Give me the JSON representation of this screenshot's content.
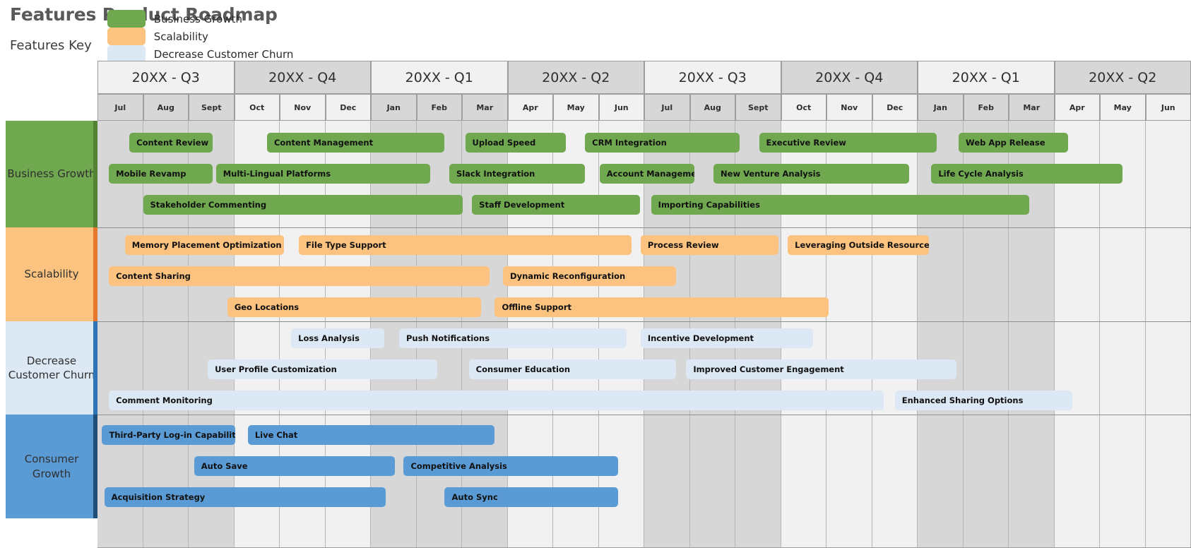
{
  "title": "Features Product Roadmap",
  "legend": {
    "title": "Features Key",
    "items": [
      {
        "label": "Business Growth",
        "color": "#6fa84f"
      },
      {
        "label": "Scalability",
        "color": "#fbc280"
      },
      {
        "label": "Decrease Customer Churn",
        "color": "#dde8f5"
      },
      {
        "label": "Consumer Growth",
        "color": "#5b9bd5"
      }
    ]
  },
  "timeline": {
    "quarters": [
      {
        "label": "20XX - Q3",
        "months": 3,
        "shaded": false
      },
      {
        "label": "20XX - Q4",
        "months": 3,
        "shaded": true
      },
      {
        "label": "20XX - Q1",
        "months": 3,
        "shaded": false
      },
      {
        "label": "20XX - Q2",
        "months": 3,
        "shaded": true
      },
      {
        "label": "20XX - Q3",
        "months": 3,
        "shaded": false
      },
      {
        "label": "20XX - Q4",
        "months": 3,
        "shaded": true
      },
      {
        "label": "20XX - Q1",
        "months": 3,
        "shaded": false
      },
      {
        "label": "20XX - Q2",
        "months": 3,
        "shaded": true
      }
    ],
    "months": [
      "Jul",
      "Aug",
      "Sept",
      "Oct",
      "Nov",
      "Dec",
      "Jan",
      "Feb",
      "Mar",
      "Apr",
      "May",
      "Jun",
      "Jul",
      "Aug",
      "Sept",
      "Oct",
      "Nov",
      "Dec",
      "Jan",
      "Feb",
      "Mar",
      "Apr",
      "May",
      "Jun"
    ]
  },
  "chart_data": {
    "type": "bar",
    "title": "Features Product Roadmap",
    "xlabel": "",
    "ylabel": "",
    "x_unit": "month",
    "x_range": [
      0,
      24
    ],
    "categories": [
      "Business Growth",
      "Scalability",
      "Decrease Customer Churn",
      "Consumer Growth"
    ],
    "bands": [
      {
        "name": "Business Growth",
        "color": "#6fa84f",
        "accent": "#548235",
        "label_bg": "#6fa84f",
        "rows": [
          [
            {
              "label": "Content Review",
              "start": 0.7,
              "end": 2.52
            },
            {
              "label": "Content Management",
              "start": 3.72,
              "end": 7.62
            },
            {
              "label": "Upload Speed",
              "start": 8.07,
              "end": 10.28
            },
            {
              "label": "CRM Integration",
              "start": 10.7,
              "end": 14.1
            },
            {
              "label": "Executive Review",
              "start": 14.52,
              "end": 18.42
            },
            {
              "label": "Web App Release",
              "start": 18.9,
              "end": 21.3
            }
          ],
          [
            {
              "label": "Mobile Revamp",
              "start": 0.25,
              "end": 2.52
            },
            {
              "label": "Multi-Lingual Platforms",
              "start": 2.6,
              "end": 7.3
            },
            {
              "label": "Slack Integration",
              "start": 7.72,
              "end": 10.7
            },
            {
              "label": "Account Management",
              "start": 11.02,
              "end": 13.1
            },
            {
              "label": "New Venture Analysis",
              "start": 13.52,
              "end": 17.82
            },
            {
              "label": "Life Cycle Analysis",
              "start": 18.3,
              "end": 22.5
            }
          ],
          [
            {
              "label": "Stakeholder Commenting",
              "start": 1.0,
              "end": 8.02
            },
            {
              "label": "Staff Development",
              "start": 8.22,
              "end": 11.9
            },
            {
              "label": "Importing Capabilities",
              "start": 12.15,
              "end": 20.45
            }
          ]
        ]
      },
      {
        "name": "Scalability",
        "color": "#fbc280",
        "accent": "#e8772e",
        "label_bg": "#fbc280",
        "rows": [
          [
            {
              "label": "Memory Placement Optimization",
              "start": 0.6,
              "end": 4.1
            },
            {
              "label": "File Type Support",
              "start": 4.42,
              "end": 11.72
            },
            {
              "label": "Process Review",
              "start": 11.92,
              "end": 14.95
            },
            {
              "label": "Leveraging Outside Resources",
              "start": 15.15,
              "end": 18.25
            }
          ],
          [
            {
              "label": "Content Sharing",
              "start": 0.25,
              "end": 8.6
            },
            {
              "label": "Dynamic Reconfiguration",
              "start": 8.9,
              "end": 12.7
            },
            {
              "label": "",
              "start": 0,
              "end": 0
            }
          ],
          [
            {
              "label": "Geo Locations",
              "start": 2.85,
              "end": 8.42
            },
            {
              "label": "Offline Support",
              "start": 8.72,
              "end": 16.05
            }
          ]
        ]
      },
      {
        "name": "Decrease Customer Churn",
        "color": "#dde8f5",
        "accent": "#2e75b6",
        "label_bg": "#dde8f5",
        "rows": [
          [
            {
              "label": "Loss Analysis",
              "start": 4.25,
              "end": 6.3
            },
            {
              "label": "Push Notifications",
              "start": 6.62,
              "end": 11.62
            },
            {
              "label": "Incentive Development",
              "start": 11.92,
              "end": 15.7
            }
          ],
          [
            {
              "label": "User Profile Customization",
              "start": 2.42,
              "end": 7.45
            },
            {
              "label": "Consumer Education",
              "start": 8.15,
              "end": 12.7
            },
            {
              "label": "Improved Customer Engagement",
              "start": 12.92,
              "end": 18.85
            }
          ],
          [
            {
              "label": "Comment Monitoring",
              "start": 0.25,
              "end": 17.25
            },
            {
              "label": "Enhanced Sharing Options",
              "start": 17.5,
              "end": 21.4
            }
          ]
        ]
      },
      {
        "name": "Consumer Growth",
        "color": "#5b9bd5",
        "accent": "#1f4e79",
        "label_bg": "#5b9bd5",
        "rows": [
          [
            {
              "label": "Third-Party Log-in Capabilities",
              "start": 0.1,
              "end": 3.02
            },
            {
              "label": "Live Chat",
              "start": 3.3,
              "end": 8.72
            },
            {
              "label": "",
              "start": 0,
              "end": 0
            }
          ],
          [
            {
              "label": "Auto Save",
              "start": 2.12,
              "end": 6.52
            },
            {
              "label": "Competitive Analysis",
              "start": 6.72,
              "end": 11.42
            }
          ],
          [
            {
              "label": "Acquisition Strategy",
              "start": 0.15,
              "end": 6.32
            },
            {
              "label": "Auto Sync",
              "start": 7.62,
              "end": 11.42
            }
          ]
        ]
      }
    ]
  }
}
